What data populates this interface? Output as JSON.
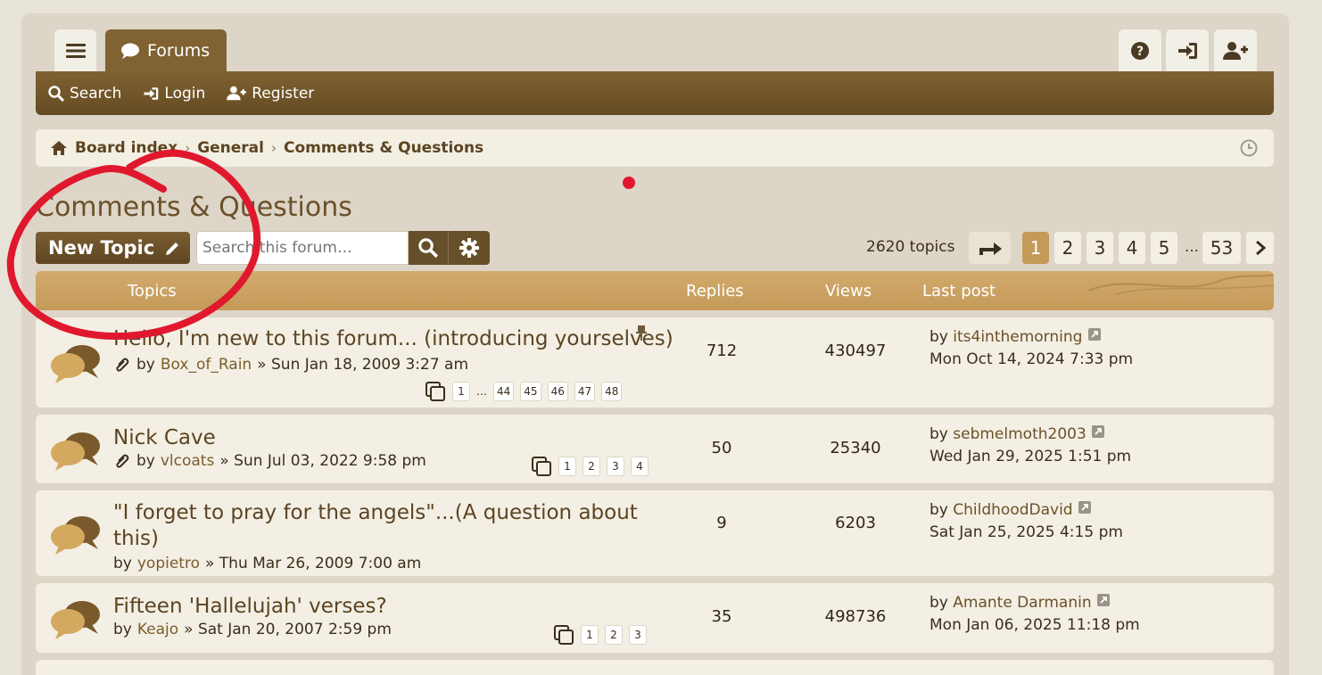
{
  "tabs": {
    "forums": "Forums"
  },
  "navbar": {
    "search": "Search",
    "login": "Login",
    "register": "Register"
  },
  "breadcrumb": {
    "home": "Board index",
    "general": "General",
    "current": "Comments & Questions"
  },
  "page": {
    "title": "Comments & Questions",
    "new_topic": "New Topic",
    "search_placeholder": "Search this forum…",
    "topic_count": "2620 topics"
  },
  "pagination": {
    "pages": [
      "1",
      "2",
      "3",
      "4",
      "5",
      "53"
    ],
    "ellipsis": "…",
    "active": "1"
  },
  "table_header": {
    "topics": "Topics",
    "replies": "Replies",
    "views": "Views",
    "last_post": "Last post"
  },
  "topics": [
    {
      "title": "Hello, I'm new to this forum... (introducing yourselves)",
      "by": "by",
      "author": "Box_of_Rain",
      "date": "» Sun Jan 18, 2009 3:27 am",
      "replies": "712",
      "views": "430497",
      "last_by": "by",
      "last_user": "its4inthemorning",
      "last_date": "Mon Oct 14, 2024 7:33 pm",
      "pages": [
        "1",
        "…",
        "44",
        "45",
        "46",
        "47",
        "48"
      ]
    },
    {
      "title": "Nick Cave",
      "by": "by",
      "author": "vlcoats",
      "date": "» Sun Jul 03, 2022 9:58 pm",
      "replies": "50",
      "views": "25340",
      "last_by": "by",
      "last_user": "sebmelmoth2003",
      "last_date": "Wed Jan 29, 2025 1:51 pm",
      "pages": [
        "1",
        "2",
        "3",
        "4"
      ]
    },
    {
      "title_line1": "\"I forget to pray for the angels\"...(A question about",
      "title_line2": "this)",
      "by": "by",
      "author": "yopietro",
      "date": "» Thu Mar 26, 2009 7:00 am",
      "replies": "9",
      "views": "6203",
      "last_by": "by",
      "last_user": "ChildhoodDavid",
      "last_date": "Sat Jan 25, 2025 4:15 pm"
    },
    {
      "title": "Fifteen 'Hallelujah' verses?",
      "by": "by",
      "author": "Keajo",
      "date": "» Sat Jan 20, 2007 2:59 pm",
      "replies": "35",
      "views": "498736",
      "last_by": "by",
      "last_user": "Amante Darmanin",
      "last_date": "Mon Jan 06, 2025 11:18 pm",
      "pages": [
        "1",
        "2",
        "3"
      ]
    }
  ],
  "colors": {
    "accent": "#806233",
    "header": "#c49a58",
    "annotation": "#e0182e"
  }
}
